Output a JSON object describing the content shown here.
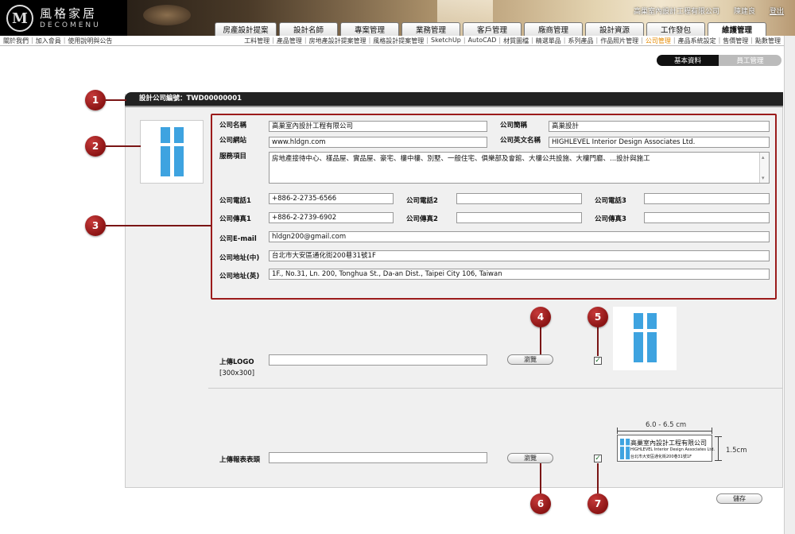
{
  "brand": {
    "cn": "風格家居",
    "en": "DECOMENU",
    "mark": "M"
  },
  "userbar": {
    "company": "高巢室內設計工程有限公司",
    "user": "陳建良",
    "logout": "登出"
  },
  "main_nav": [
    "房產設計提案",
    "設計名師",
    "專案管理",
    "業務管理",
    "客戶管理",
    "廠商管理",
    "設計資源",
    "工作發包",
    "維護管理"
  ],
  "main_nav_active": "維護管理",
  "sub_left": [
    "關於我們",
    "加入會員",
    "使用說明與公告"
  ],
  "sub_right": [
    "工料管理",
    "產品管理",
    "房地產設計提案管理",
    "風格設計提案管理",
    "SketchUp",
    "AutoCAD",
    "材質圖檔",
    "精選單品",
    "系列產品",
    "作品照片管理",
    "公司管理",
    "產品系統設定",
    "售價管理",
    "點數管理"
  ],
  "sub_right_active": "公司管理",
  "tabs2": {
    "basic": "基本資料",
    "staff": "員工管理"
  },
  "panel": {
    "header": "設計公司編號：TWD00000001"
  },
  "form": {
    "name_label": "公司名稱",
    "name": "高巢室內設計工程有限公司",
    "short_label": "公司簡稱",
    "short": "高巢設計",
    "web_label": "公司網站",
    "web": "www.hldgn.com",
    "en_name_label": "公司英文名稱",
    "en_name": "HIGHLEVEL Interior Design Associates Ltd.",
    "service_label": "服務項目",
    "service": "房地產接待中心、樣品屋、實品屋、豪宅、樓中樓、別墅、一般住宅、俱樂部及會館、大樓公共設施、大樓門廳、...設計與施工",
    "phone1_label": "公司電話1",
    "phone1": "+886-2-2735-6566",
    "phone2_label": "公司電話2",
    "phone2": "",
    "phone3_label": "公司電話3",
    "phone3": "",
    "fax1_label": "公司傳真1",
    "fax1": "+886-2-2739-6902",
    "fax2_label": "公司傳真2",
    "fax2": "",
    "fax3_label": "公司傳真3",
    "fax3": "",
    "email_label": "公司E-mail",
    "email": "hldgn200@gmail.com",
    "addr_cn_label": "公司地址(中)",
    "addr_cn": "台北市大安區通化街200巷31號1F",
    "addr_en_label": "公司地址(英)",
    "addr_en": "1F., No.31, Ln. 200, Tonghua St., Da-an Dist., Taipei City 106, Taiwan"
  },
  "upload_logo": {
    "label": "上傳LOGO",
    "size": "[300x300]",
    "browse": "瀏覽",
    "value": ""
  },
  "upload_header": {
    "label": "上傳報表表頭",
    "browse": "瀏覽",
    "value": ""
  },
  "header_preview": {
    "name": "高巢室內設計工程有限公司",
    "en": "HIGHLEVEL Interior Design Associates Ltd.",
    "addr": "台北市大安區通化街200巷31號1F",
    "width_label": "6.0 - 6.5 cm",
    "height_label": "1.5cm"
  },
  "save": "儲存",
  "callouts": [
    "1",
    "2",
    "3",
    "4",
    "5",
    "6",
    "7"
  ],
  "colors": {
    "accent_red": "#9b1b1b",
    "logo_blue": "#3ea3e0",
    "nav_active": "#e58a00"
  }
}
